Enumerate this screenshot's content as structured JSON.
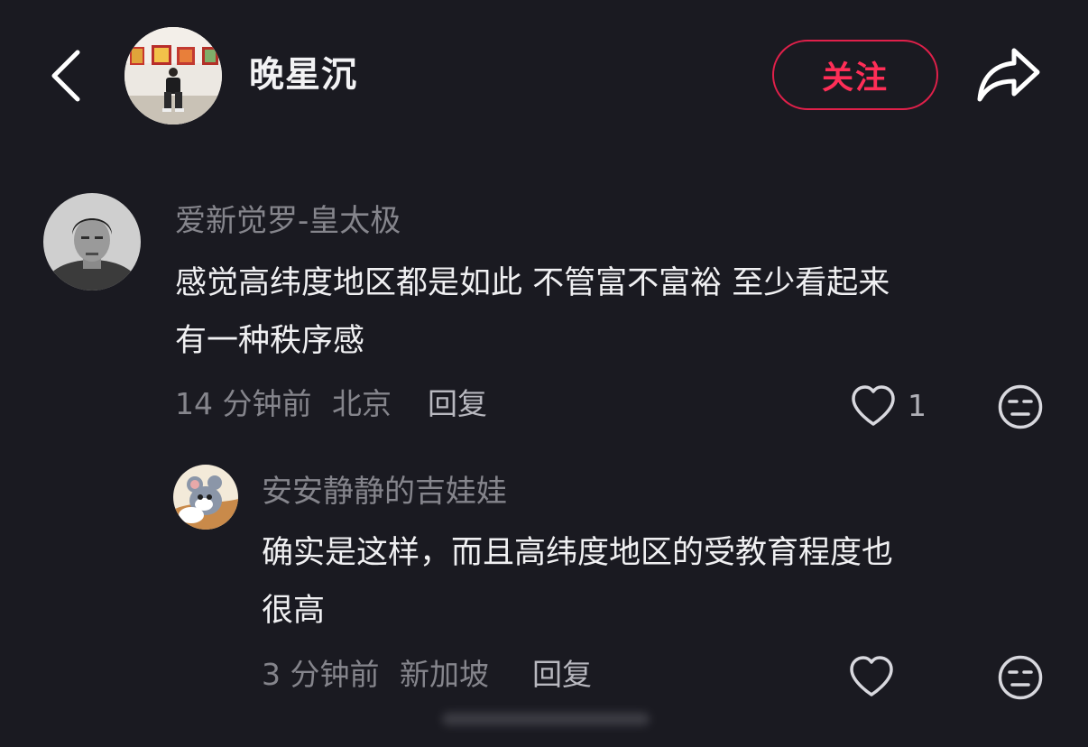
{
  "header": {
    "back_icon": "chevron-left-icon",
    "author_name": "晚星沉",
    "follow_label": "关注",
    "share_icon": "share-arrow-icon",
    "accent_color": "#ff2e57"
  },
  "comments": [
    {
      "user": "爱新觉罗-皇太极",
      "text": "感觉高纬度地区都是如此 不管富不富裕 至少看起来\n有一种秩序感",
      "time": "14 分钟前",
      "location": "北京",
      "reply_label": "回复",
      "likes": "1",
      "like_icon": "heart-outline-icon",
      "dislike_icon": "unamused-face-icon"
    },
    {
      "user": "安安静静的吉娃娃",
      "text": "确实是这样，而且高纬度地区的受教育程度也\n很高",
      "time": "3 分钟前",
      "location": "新加坡",
      "reply_label": "回复",
      "likes": "",
      "like_icon": "heart-outline-icon",
      "dislike_icon": "unamused-face-icon"
    }
  ]
}
